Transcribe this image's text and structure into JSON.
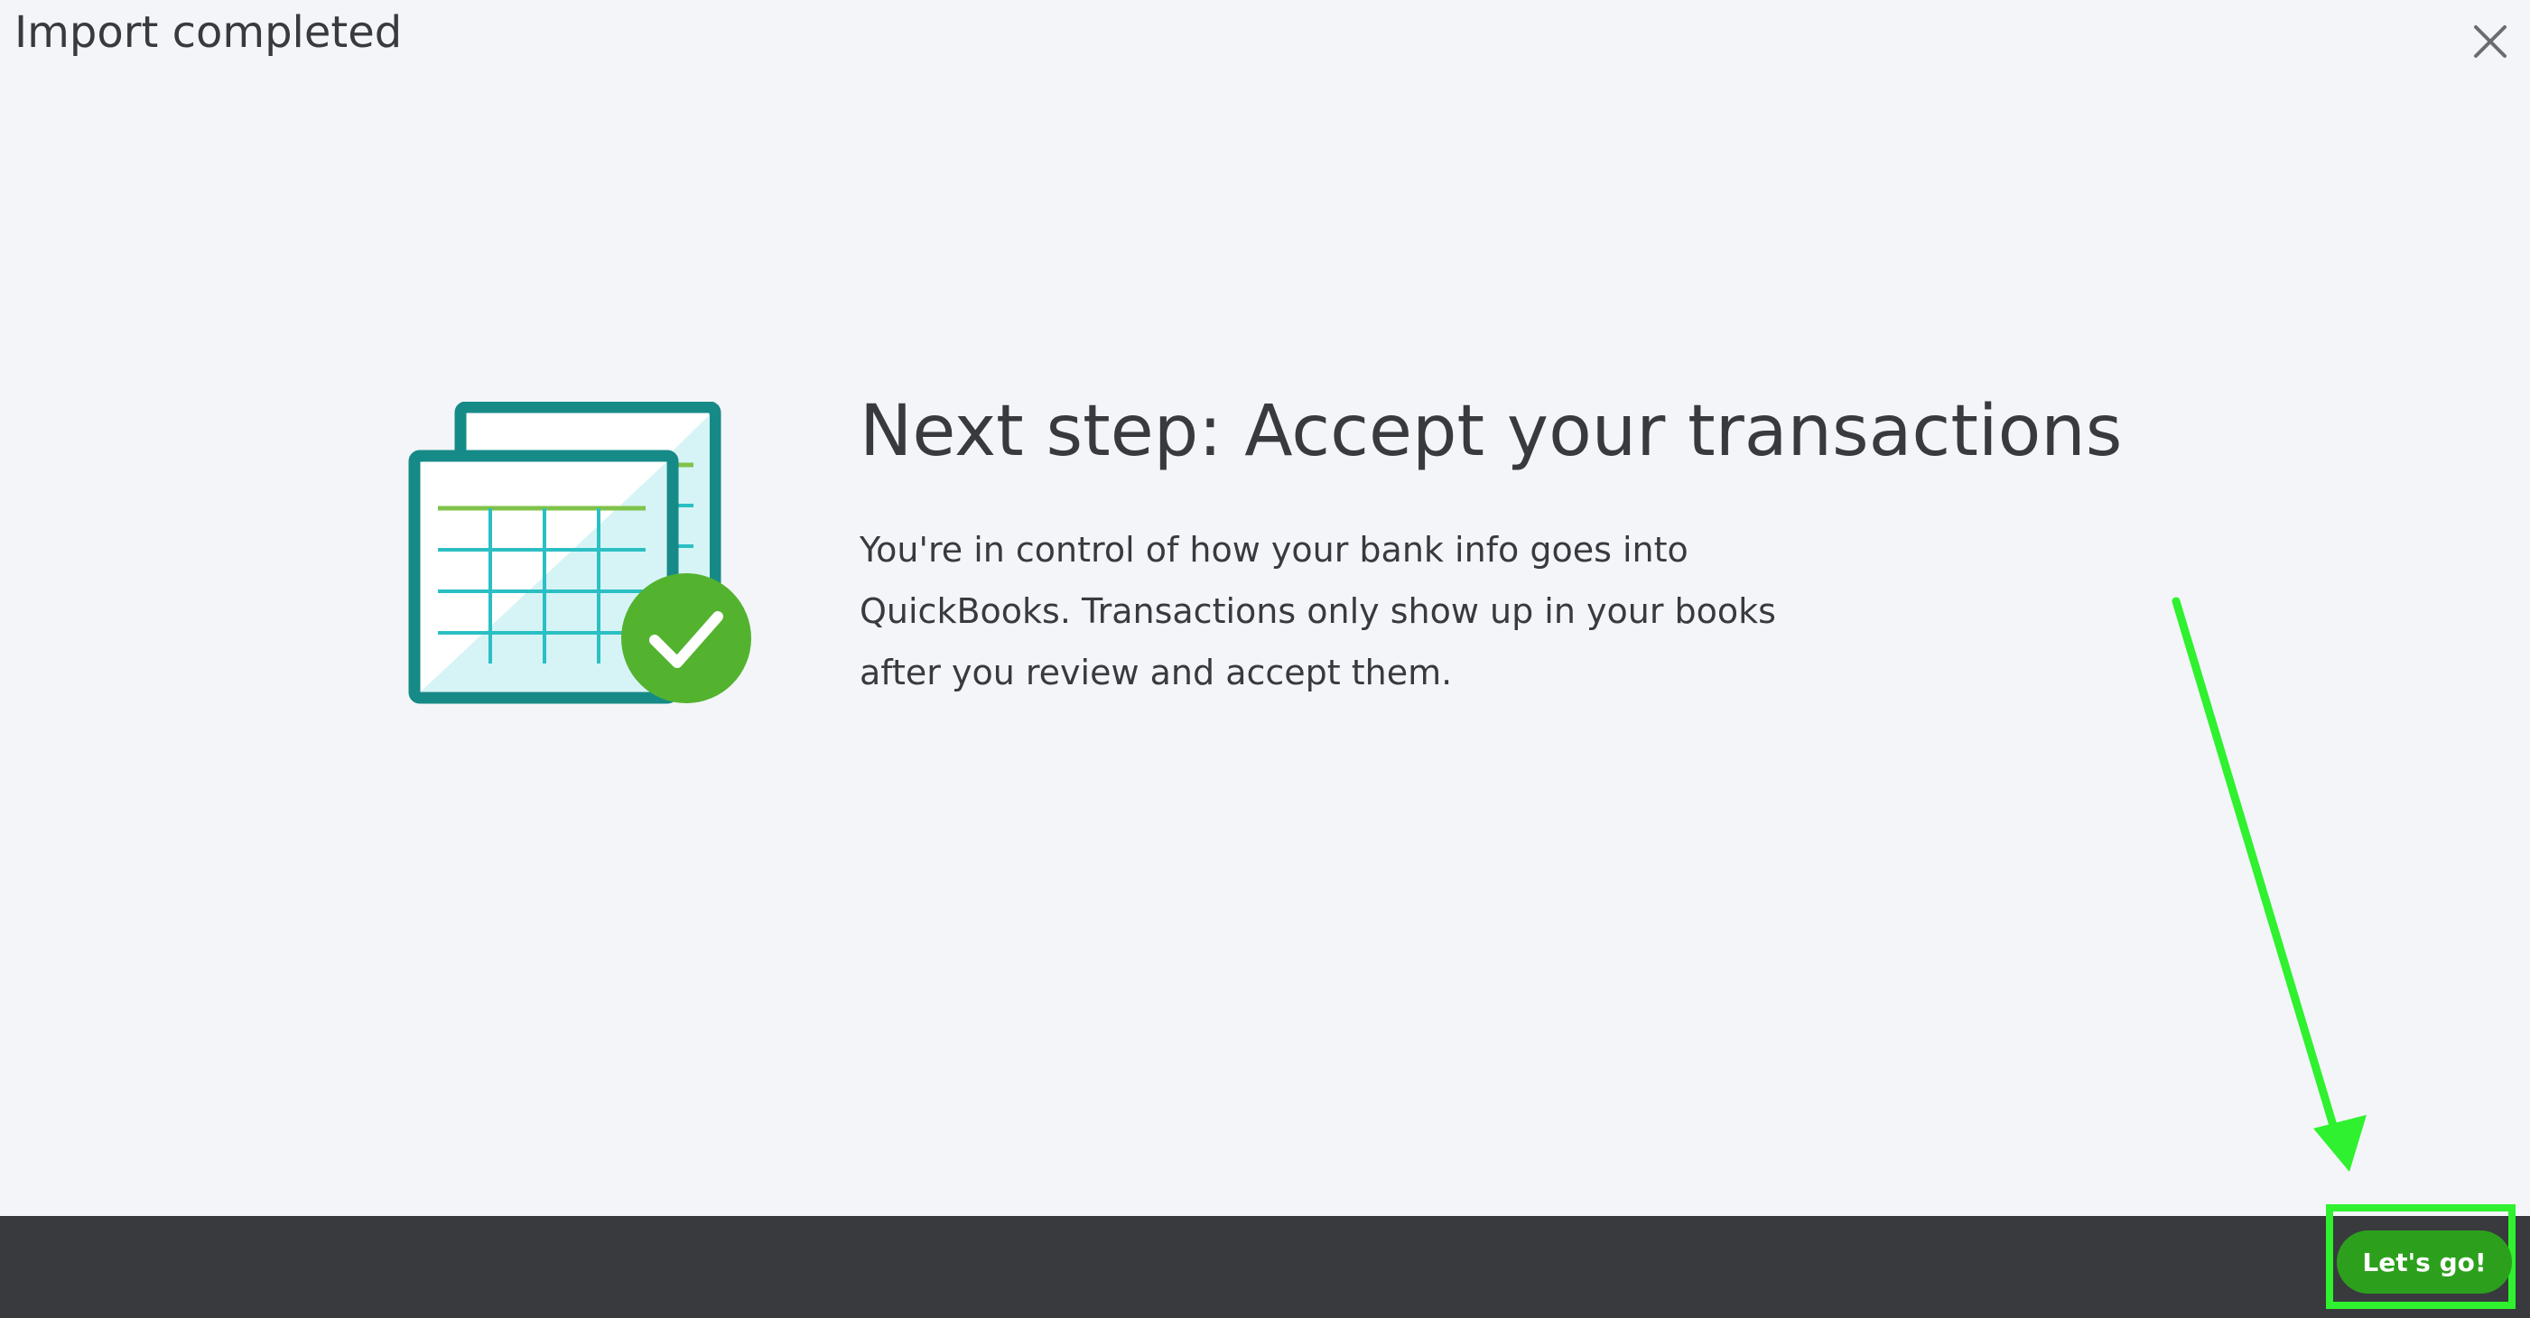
{
  "dialog": {
    "title": "Import completed",
    "close_icon": "close-icon"
  },
  "main": {
    "illustration_icon": "calendar-check-icon",
    "heading": "Next step: Accept your transactions",
    "body": "You're in control of how your bank info goes into QuickBooks. Transactions only show up in your books after you review and accept them."
  },
  "footer": {
    "primary_button_label": "Let's go!"
  },
  "colors": {
    "background": "#f4f5f8",
    "text": "#393a3d",
    "footer": "#393a3d",
    "button_green": "#2ca01c",
    "check_green": "#53b32f",
    "illustration_teal": "#168a87",
    "annotation_green": "#2ff12f"
  }
}
